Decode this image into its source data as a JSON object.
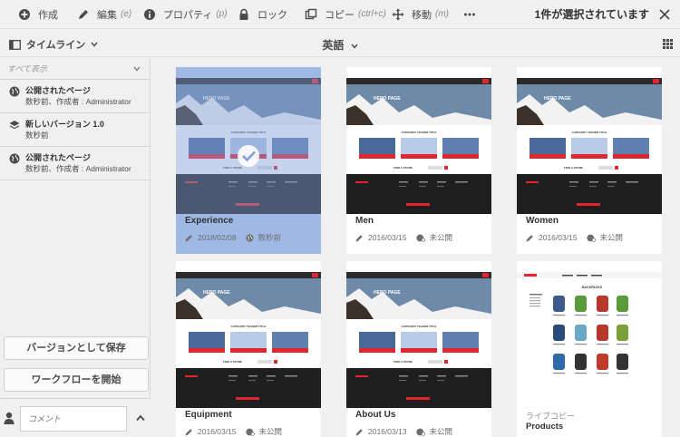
{
  "actions": [
    {
      "id": "create",
      "label": "作成",
      "shortcut": "",
      "icon": "plus-circle-icon"
    },
    {
      "id": "edit",
      "label": "編集",
      "shortcut": "(e)",
      "icon": "pencil-icon"
    },
    {
      "id": "properties",
      "label": "プロパティ",
      "shortcut": "(p)",
      "icon": "info-circle-icon"
    },
    {
      "id": "lock",
      "label": "ロック",
      "shortcut": "",
      "icon": "lock-icon"
    },
    {
      "id": "copy",
      "label": "コピー",
      "shortcut": "(ctrl+c)",
      "icon": "copy-icon"
    },
    {
      "id": "move",
      "label": "移動",
      "shortcut": "(m)",
      "icon": "move-icon"
    },
    {
      "id": "more",
      "label": "",
      "shortcut": "",
      "icon": "more-icon"
    }
  ],
  "selection": {
    "count_text": "1件が選択されています"
  },
  "rail": {
    "toggle_label": "タイムライン",
    "filter_label": "すべて表示",
    "items": [
      {
        "title": "公開されたページ",
        "detail": "数秒前、作成者 : Administrator",
        "icon": "globe-icon"
      },
      {
        "title": "新しいバージョン 1.0",
        "detail": "数秒前",
        "icon": "layers-icon"
      },
      {
        "title": "公開されたページ",
        "detail": "数秒前、作成者 : Administrator",
        "icon": "globe-icon"
      }
    ],
    "save_version_label": "バージョンとして保存",
    "start_workflow_label": "ワークフローを開始",
    "comment_placeholder": "コメント"
  },
  "breadcrumb": {
    "current": "英語"
  },
  "thumb_text": {
    "hero": "HERO PAGE",
    "teaser": "CATEGORY TEASER TITLE",
    "find_store": "FIND A STORE",
    "products_header": "BACKPACKS"
  },
  "cards": [
    {
      "title": "Experience",
      "date": "2018/02/08",
      "status": "数秒前",
      "selected": true,
      "type": "page"
    },
    {
      "title": "Men",
      "date": "2016/03/15",
      "status": "未公開",
      "selected": false,
      "type": "page"
    },
    {
      "title": "Women",
      "date": "2016/03/15",
      "status": "未公開",
      "selected": false,
      "type": "page"
    },
    {
      "title": "Equipment",
      "date": "2016/03/15",
      "status": "未公開",
      "selected": false,
      "type": "page"
    },
    {
      "title": "About Us",
      "date": "2016/03/13",
      "status": "未公開",
      "selected": false,
      "type": "page"
    },
    {
      "title": "Products",
      "subtitle": "ライブコピー",
      "selected": false,
      "type": "products"
    }
  ],
  "colors": {
    "accent": "#2680eb",
    "selected_card": "#9fb8e4",
    "site_red": "#e0262f",
    "footer_dark": "#1f1f1f"
  }
}
